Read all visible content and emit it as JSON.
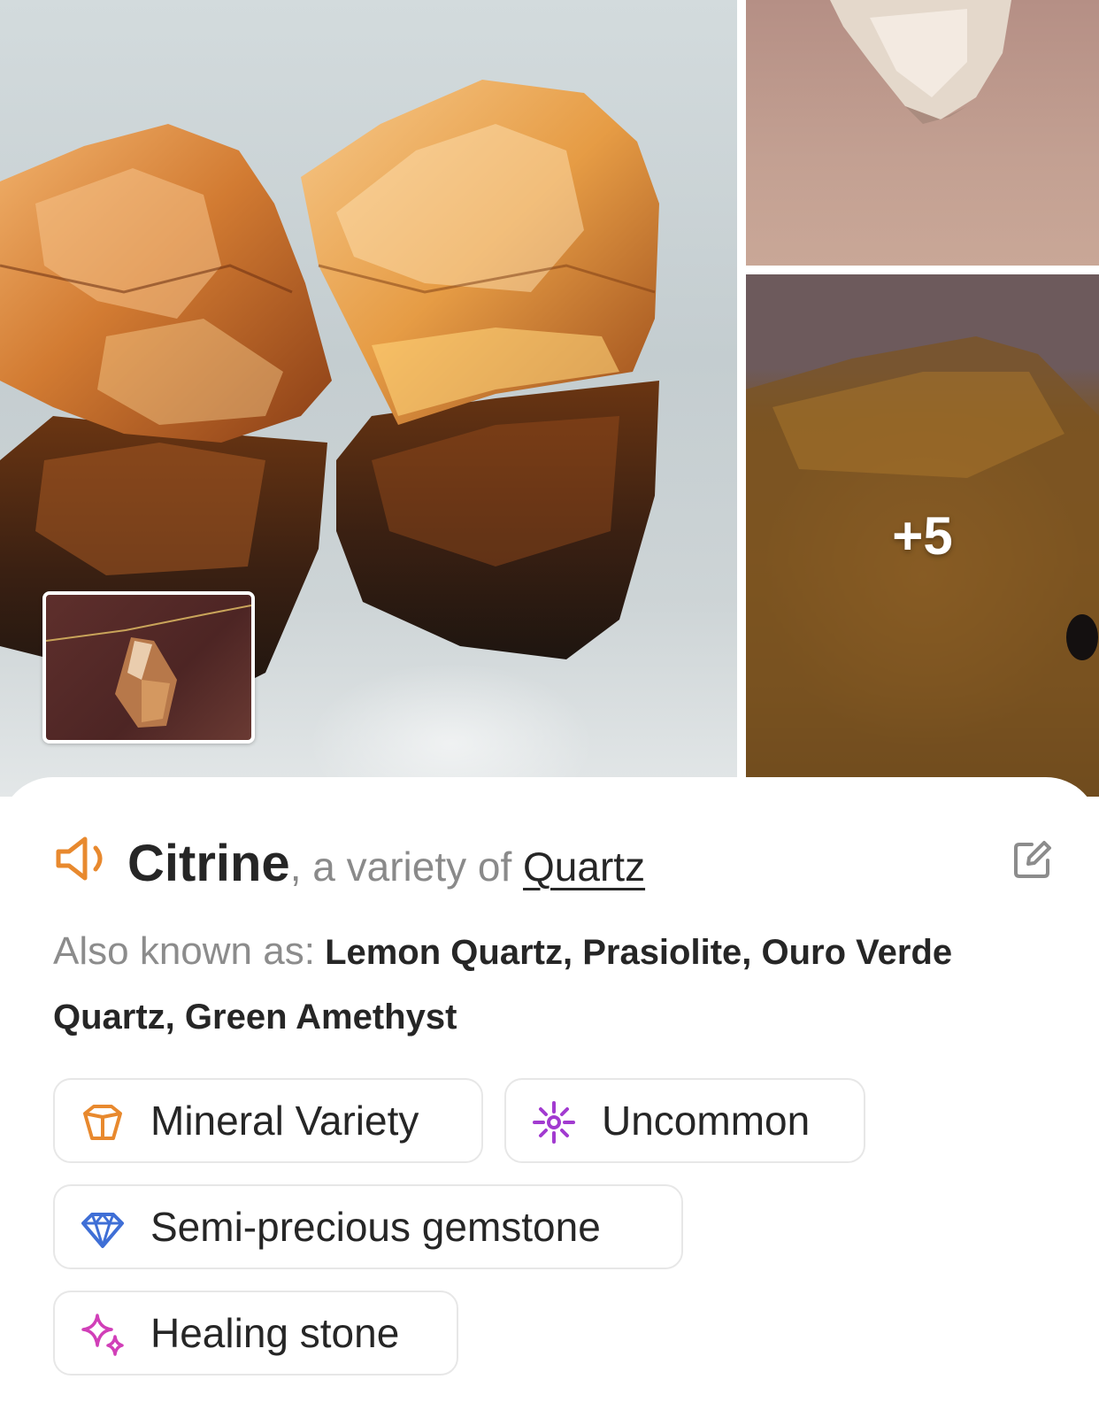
{
  "gallery": {
    "main_photo": "Citrine rough crystals photo",
    "top_right_photo": "Pale quartz crystal photo",
    "bottom_right_photo": "Citrine crystal point photo",
    "thumbnail_photo": "Faceted citrine pendant photo",
    "more_count": "+5"
  },
  "header": {
    "name": "Citrine",
    "variety_prefix": ", a variety of ",
    "variety_link": "Quartz",
    "speaker_icon": "speaker-icon",
    "edit_icon": "edit-icon"
  },
  "aka": {
    "label": "Also known as:",
    "values": "Lemon Quartz, Prasiolite, Ouro Verde Quartz, Green Amethyst"
  },
  "tags": [
    {
      "label": "Mineral Variety",
      "icon": "crystal-icon",
      "color": "#e8892e"
    },
    {
      "label": "Uncommon",
      "icon": "sparkle-rarity-icon",
      "color": "#a23bd0"
    },
    {
      "label": "Semi-precious gemstone",
      "icon": "gem-icon",
      "color": "#3f6fd6"
    },
    {
      "label": "Healing stone",
      "icon": "sparkles-icon",
      "color": "#d13fb8"
    }
  ],
  "colors": {
    "accent_orange": "#e8892e",
    "text_primary": "#262626",
    "text_secondary": "#8a8a8a",
    "chip_border": "#e7e7e7"
  }
}
